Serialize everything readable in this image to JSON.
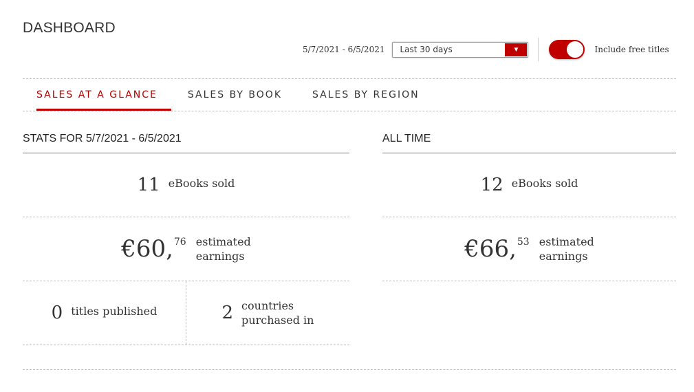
{
  "header": {
    "title": "DASHBOARD",
    "date_range": "5/7/2021 - 6/5/2021",
    "period_select": {
      "value": "Last 30 days",
      "icon": "caret-down-icon"
    },
    "include_free_toggle": {
      "label": "Include free titles",
      "on": true
    }
  },
  "colors": {
    "accent": "#c00000",
    "text": "#333333",
    "divider": "#bbbbbb"
  },
  "tabs": [
    {
      "label": "SALES AT A GLANCE",
      "active": true
    },
    {
      "label": "SALES BY BOOK",
      "active": false
    },
    {
      "label": "SALES BY REGION",
      "active": false
    }
  ],
  "period_stats": {
    "title": "STATS FOR 5/7/2021 - 6/5/2021",
    "ebooks_sold": {
      "value": "11",
      "label": "eBooks sold"
    },
    "earnings": {
      "whole": "€60,",
      "cents": "76",
      "label_line1": "estimated",
      "label_line2": "earnings"
    },
    "titles_published": {
      "value": "0",
      "label": "titles published"
    },
    "countries": {
      "value": "2",
      "label_line1": "countries",
      "label_line2": "purchased in"
    }
  },
  "all_time_stats": {
    "title": "ALL TIME",
    "ebooks_sold": {
      "value": "12",
      "label": "eBooks sold"
    },
    "earnings": {
      "whole": "€66,",
      "cents": "53",
      "label_line1": "estimated",
      "label_line2": "earnings"
    }
  }
}
